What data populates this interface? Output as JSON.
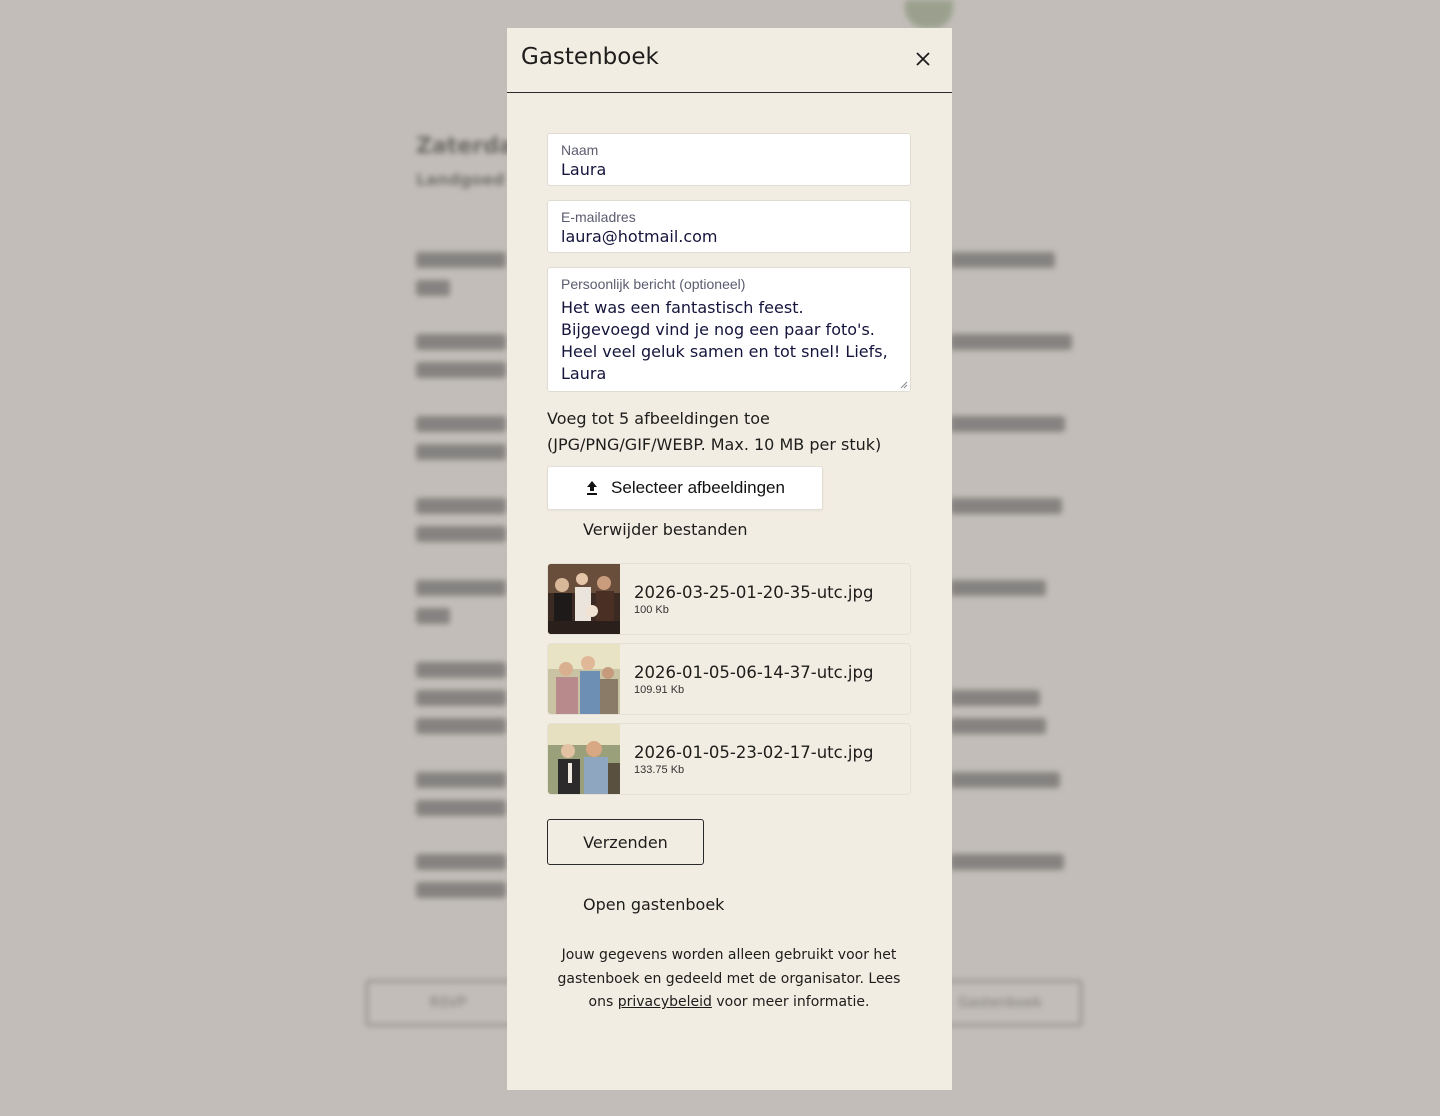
{
  "background": {
    "heading": "Zaterdag",
    "subheading": "Landgoed",
    "buttons": [
      "RSVP",
      "Gastenboek"
    ]
  },
  "modal": {
    "title": "Gastenboek",
    "close_icon": "close-icon"
  },
  "form": {
    "name_label": "Naam",
    "name_value": "Laura",
    "email_label": "E-mailadres",
    "email_value": "laura@hotmail.com",
    "message_label": "Persoonlijk bericht (optioneel)",
    "message_value": "Het was een fantastisch feest. Bijgevoegd vind je nog een paar foto's. Heel veel geluk samen en tot snel! Liefs, Laura",
    "upload_hint_line1": "Voeg tot 5 afbeeldingen toe",
    "upload_hint_line2": "(JPG/PNG/GIF/WEBP. Max. 10 MB per stuk)",
    "select_button": "Selecteer afbeeldingen",
    "select_icon": "upload-icon",
    "remove_files": "Verwijder bestanden",
    "files": [
      {
        "name": "2026-03-25-01-20-35-utc.jpg",
        "size": "100 Kb"
      },
      {
        "name": "2026-01-05-06-14-37-utc.jpg",
        "size": "109.91 Kb"
      },
      {
        "name": "2026-01-05-23-02-17-utc.jpg",
        "size": "133.75 Kb"
      }
    ],
    "submit": "Verzenden",
    "open_guestbook": "Open gastenboek",
    "privacy_before": "Jouw gegevens worden alleen gebruikt voor het gastenboek en gedeeld met de organisator. Lees ons ",
    "privacy_link": "privacybeleid",
    "privacy_after": " voor meer informatie."
  },
  "colors": {
    "overlay": "#c2bdb8",
    "modal_bg": "#f2ede2",
    "input_text": "#14143c"
  }
}
